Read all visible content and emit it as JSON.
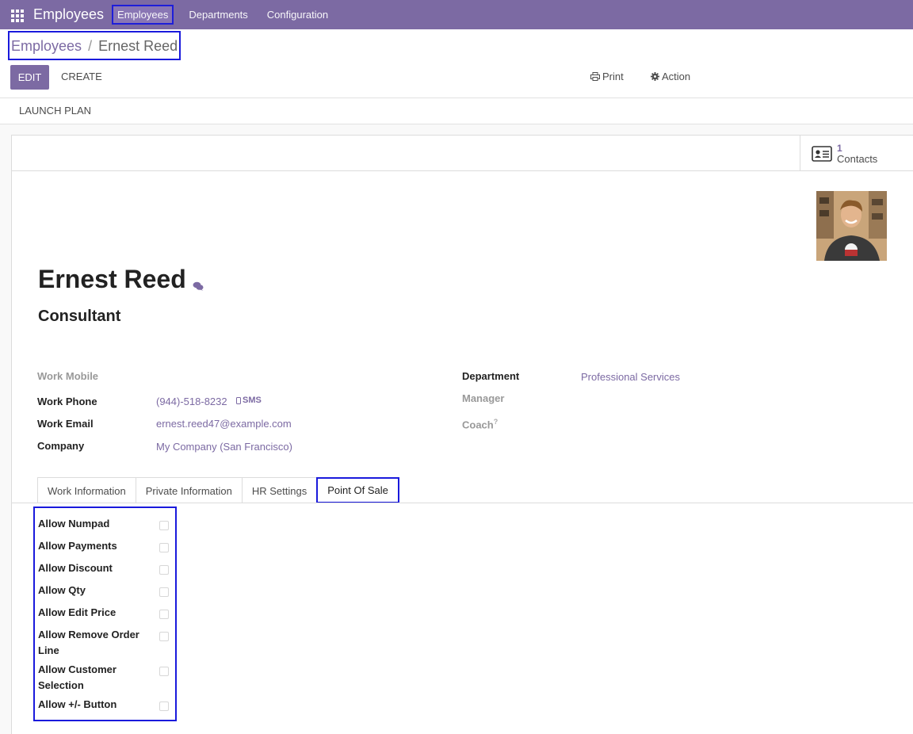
{
  "navbar": {
    "app_title": "Employees",
    "menu": [
      "Employees",
      "Departments",
      "Configuration"
    ]
  },
  "breadcrumb": {
    "parent": "Employees",
    "separator": "/",
    "current": "Ernest Reed"
  },
  "toolbar": {
    "edit_label": "EDIT",
    "create_label": "CREATE",
    "print_label": "Print",
    "action_label": "Action",
    "launch_plan_label": "LAUNCH PLAN"
  },
  "smart_button": {
    "count": "1",
    "label": "Contacts"
  },
  "employee": {
    "name": "Ernest Reed",
    "job_title": "Consultant"
  },
  "fields_left": [
    {
      "label": "Work Mobile",
      "value": ""
    },
    {
      "label": "Work Phone",
      "value": "(944)-518-8232"
    },
    {
      "label": "Work Email",
      "value": "ernest.reed47@example.com"
    },
    {
      "label": "Company",
      "value": "My Company (San Francisco)"
    }
  ],
  "sms_label": "SMS",
  "fields_right": [
    {
      "label": "Department",
      "value": "Professional Services"
    },
    {
      "label": "Manager",
      "value": ""
    },
    {
      "label": "Coach",
      "value": ""
    }
  ],
  "coach_help": "?",
  "tabs": [
    "Work Information",
    "Private Information",
    "HR Settings",
    "Point Of Sale"
  ],
  "pos_settings": [
    {
      "label": "Allow Numpad",
      "checked": false
    },
    {
      "label": "Allow Payments",
      "checked": false
    },
    {
      "label": "Allow Discount",
      "checked": false
    },
    {
      "label": "Allow Qty",
      "checked": false
    },
    {
      "label": "Allow Edit Price",
      "checked": false
    },
    {
      "label": "Allow Remove Order Line",
      "checked": false
    },
    {
      "label": "Allow Customer Selection",
      "checked": false
    },
    {
      "label": "Allow +/- Button",
      "checked": false
    }
  ],
  "colors": {
    "brand": "#7c6aa3",
    "highlight_border": "#1a1adc"
  }
}
